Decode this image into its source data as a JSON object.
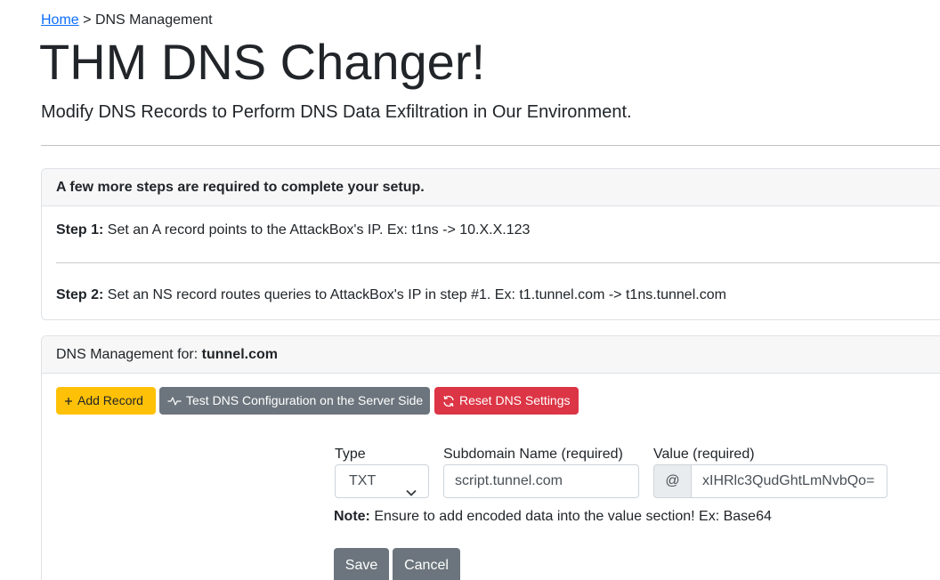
{
  "breadcrumb": {
    "home_label": "Home",
    "separator": ">",
    "current": "DNS Management"
  },
  "page": {
    "title": "THM DNS Changer!",
    "lead": "Modify DNS Records to Perform DNS Data Exfiltration in Our Environment."
  },
  "setup_card": {
    "header": "A few more steps are required to complete your setup.",
    "step1_label": "Step 1:",
    "step1_text": "Set an A record points to the AttackBox's IP. Ex: t1ns -> 10.X.X.123",
    "step2_label": "Step 2:",
    "step2_text": "Set an NS record routes queries to AttackBox's IP in step #1. Ex: t1.tunnel.com -> t1ns.tunnel.com"
  },
  "dns_card": {
    "header_prefix": "DNS Management for:",
    "domain": "tunnel.com",
    "buttons": {
      "add_record": "Add Record",
      "test_dns": "Test DNS Configuration on the Server Side",
      "reset_dns": "Reset DNS Settings"
    },
    "form": {
      "type_label": "Type",
      "type_value": "TXT",
      "subdomain_label": "Subdomain Name (required)",
      "subdomain_value": "script.tunnel.com",
      "value_label": "Value (required)",
      "value_prefix": "@",
      "value_value": "xIHRlc3QudGhtLmNvbQo=",
      "note_label": "Note:",
      "note_text": "Ensure to add encoded data into the value section! Ex: Base64",
      "save_label": "Save",
      "cancel_label": "Cancel"
    }
  },
  "colors": {
    "link": "#0d6efd",
    "warning": "#ffc107",
    "secondary": "#6c757d",
    "danger": "#dc3545"
  },
  "icons": {
    "add_record": "plus-icon",
    "test_dns": "activity-icon",
    "reset_dns": "refresh-icon",
    "type_select": "chevron-down-icon"
  }
}
